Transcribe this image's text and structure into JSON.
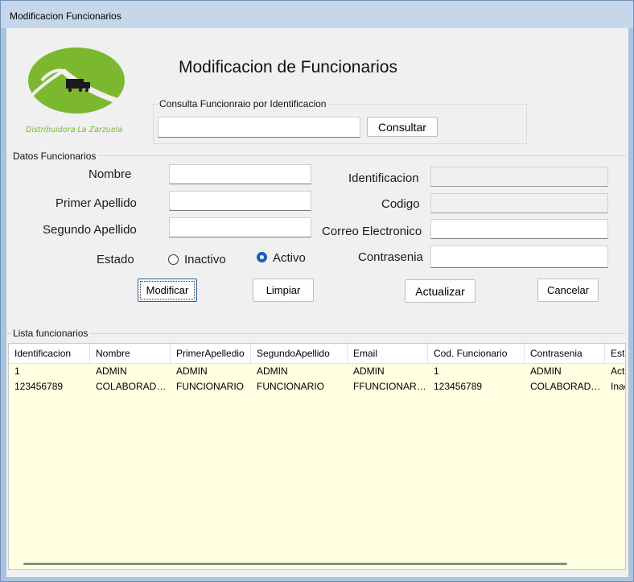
{
  "window": {
    "title": "Modificacion Funcionarios"
  },
  "logo": {
    "text": "Distribuidora La Zarzuela",
    "color": "#7cb82f"
  },
  "heading": "Modificacion de Funcionarios",
  "consulta": {
    "group_label": "Consulta Funcionraio por Identificacion",
    "input_value": "",
    "button_label": "Consultar"
  },
  "datos": {
    "group_label": "Datos Funcionarios",
    "nombre_label": "Nombre",
    "primer_apellido_label": "Primer Apellido",
    "segundo_apellido_label": "Segundo Apellido",
    "estado_label": "Estado",
    "inactivo_label": "Inactivo",
    "activo_label": "Activo",
    "estado_selected": "Activo",
    "identificacion_label": "Identificacion",
    "codigo_label": "Codigo",
    "correo_label": "Correo Electronico",
    "contrasena_label": "Contrasenia",
    "nombre_value": "",
    "primer_apellido_value": "",
    "segundo_apellido_value": "",
    "identificacion_value": "",
    "codigo_value": "",
    "correo_value": "",
    "contrasena_value": ""
  },
  "buttons": {
    "modificar": "Modificar",
    "limpiar": "Limpiar",
    "actualizar": "Actualizar",
    "cancelar": "Cancelar"
  },
  "lista": {
    "group_label": "Lista funcionarios",
    "columns": [
      "Identificacion",
      "Nombre",
      "PrimerApelledio",
      "SegundoApellido",
      "Email",
      "Cod. Funcionario",
      "Contrasenia",
      "Estado"
    ],
    "rows": [
      [
        "1",
        "ADMIN",
        "ADMIN",
        "ADMIN",
        "ADMIN",
        "1",
        "ADMIN",
        "Activo"
      ],
      [
        "123456789",
        "COLABORADOR",
        "FUNCIONARIO",
        "FUNCIONARIO",
        "FFUNCIONARIO@GMAIL.COM",
        "123456789",
        "COLABORADOR",
        "Inactivo"
      ]
    ]
  }
}
